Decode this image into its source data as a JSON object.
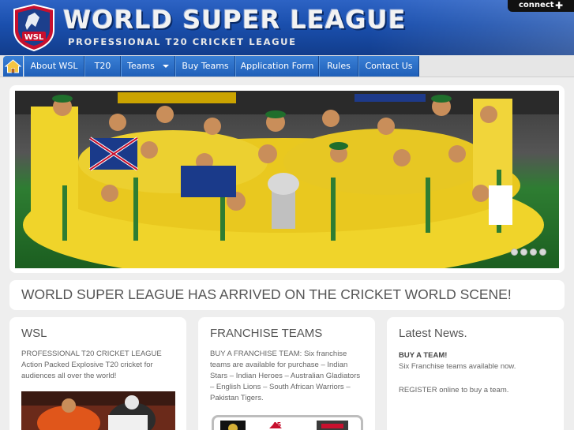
{
  "header": {
    "title": "WORLD SUPER LEAGUE",
    "subtitle": "PROFESSIONAL T20 CRICKET LEAGUE",
    "logo_text": "WSL",
    "connect_label": "connect",
    "connect_icon": "plus-icon"
  },
  "nav": {
    "home_icon": "home-icon",
    "items": [
      {
        "label": "About WSL"
      },
      {
        "label": "T20"
      },
      {
        "label": "Teams"
      },
      {
        "label": "Buy Teams"
      },
      {
        "label": "Application Form"
      },
      {
        "label": "Rules"
      },
      {
        "label": "Contact Us"
      }
    ]
  },
  "slider": {
    "dot_count": 4
  },
  "banner": {
    "text": "WORLD SUPER LEAGUE HAS ARRIVED ON THE CRICKET WORLD SCENE!"
  },
  "columns": {
    "wsl": {
      "title": "WSL",
      "line1": "PROFESSIONAL T20 CRICKET LEAGUE",
      "line2": "Action Packed Explosive T20 cricket for audiences all over the world!"
    },
    "franchise": {
      "title": "FRANCHISE TEAMS",
      "text": "BUY A FRANCHISE TEAM: Six franchise teams are available for purchase – Indian Stars – Indian Heroes – Australian Gladiators – English Lions – South African Warriors – Pakistan Tigers."
    },
    "news": {
      "title": "Latest News.",
      "headline": "BUY A TEAM!",
      "line1": "Six Franchise teams available now.",
      "line2": "REGISTER online to buy a team."
    }
  },
  "colors": {
    "header_blue": "#1a4fad",
    "nav_blue": "#2a6cc8",
    "page_bg": "#eeeeee"
  }
}
